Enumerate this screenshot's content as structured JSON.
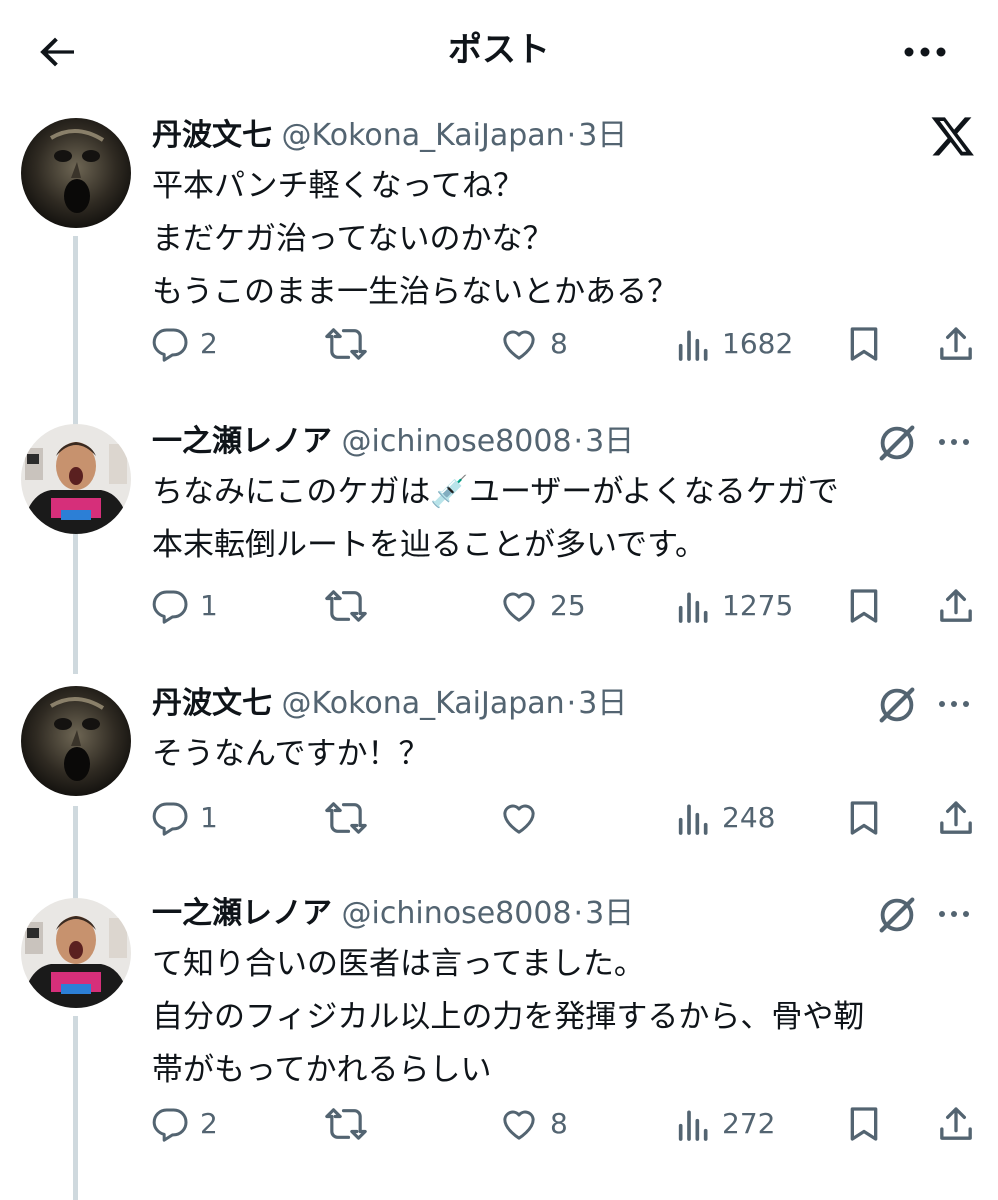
{
  "header": {
    "title": "ポスト",
    "back_icon": "arrow-left-icon",
    "more_icon": "more-horizontal-icon"
  },
  "posts": [
    {
      "author": {
        "name": "丹波文七",
        "handle": "@Kokona_KaiJapan",
        "avatar": "dark-face-avatar"
      },
      "separator": "·",
      "time": "3日",
      "lines": [
        "平本パンチ軽くなってね？",
        "まだケガ治ってないのかな？",
        "もうこのまま一生治らないとかある？"
      ],
      "stats": {
        "replies": "2",
        "reposts": "",
        "likes": "8",
        "views": "1682"
      }
    },
    {
      "author": {
        "name": "一之瀬レノア",
        "handle": "@ichinose8008",
        "avatar": "man-shouting-avatar"
      },
      "separator": "·",
      "time": "3日",
      "lines": [
        "ちなみにこのケガは💉ユーザーがよくなるケガで",
        "本末転倒ルートを辿ることが多いです。"
      ],
      "stats": {
        "replies": "1",
        "reposts": "",
        "likes": "25",
        "views": "1275"
      }
    },
    {
      "author": {
        "name": "丹波文七",
        "handle": "@Kokona_KaiJapan",
        "avatar": "dark-face-avatar"
      },
      "separator": "·",
      "time": "3日",
      "lines": [
        "そうなんですか！？"
      ],
      "stats": {
        "replies": "1",
        "reposts": "",
        "likes": "",
        "views": "248"
      }
    },
    {
      "author": {
        "name": "一之瀬レノア",
        "handle": "@ichinose8008",
        "avatar": "man-shouting-avatar"
      },
      "separator": "·",
      "time": "3日",
      "lines": [
        "て知り合いの医者は言ってました。",
        "自分のフィジカル以上の力を発揮するから、骨や靭",
        "帯がもってかれるらしい"
      ],
      "stats": {
        "replies": "2",
        "reposts": "",
        "likes": "8",
        "views": "272"
      }
    }
  ],
  "colors": {
    "text": "#0f1419",
    "secondary": "#536471",
    "thread_line": "#cfd9de",
    "background": "#ffffff"
  }
}
